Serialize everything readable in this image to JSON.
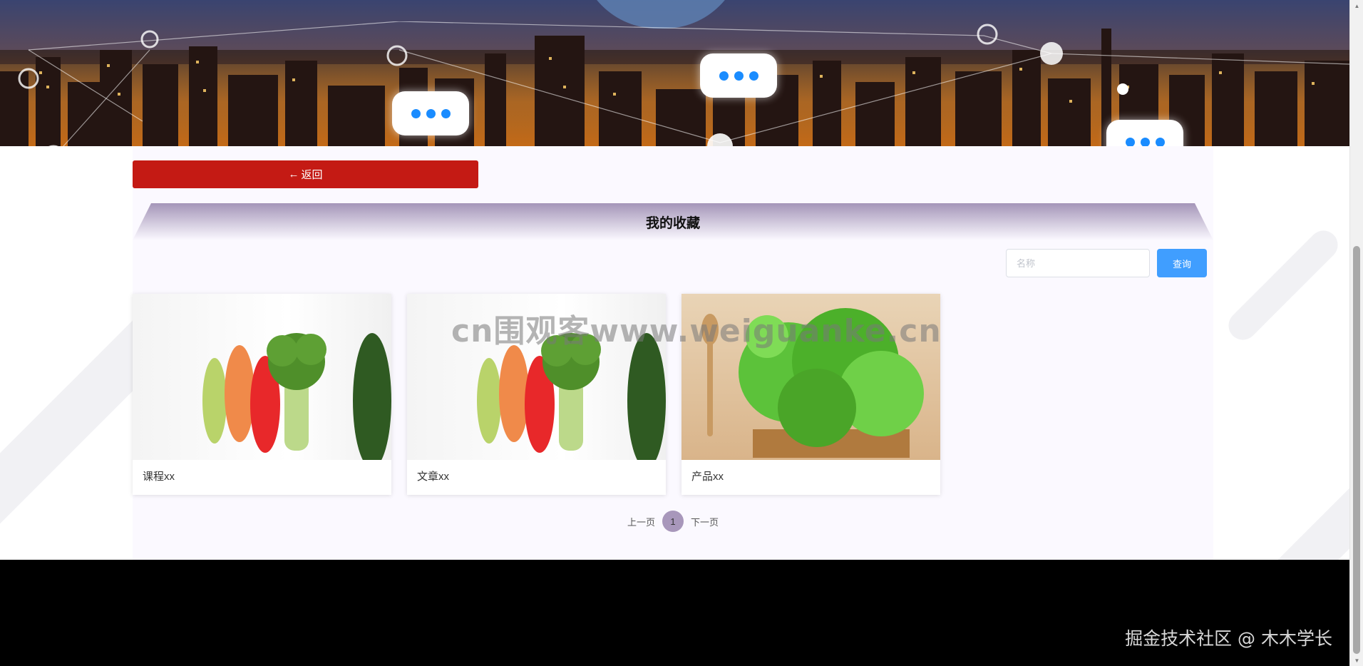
{
  "header": {
    "back_label": "返回"
  },
  "section": {
    "title": "我的收藏"
  },
  "search": {
    "placeholder": "名称",
    "value": "",
    "button_label": "查询"
  },
  "favorites": [
    {
      "label": "课程xx"
    },
    {
      "label": "文章xx"
    },
    {
      "label": "产品xx"
    }
  ],
  "pagination": {
    "prev_label": "上一页",
    "current_page": "1",
    "next_label": "下一页"
  },
  "overlay": {
    "watermark": "cn围观客www.weiguanke.cn",
    "credit": "掘金技术社区 @ 木木学长"
  },
  "colors": {
    "back_button": "#c41a14",
    "search_button": "#409eff",
    "active_page": "#a897bb",
    "footer": "#000000"
  }
}
